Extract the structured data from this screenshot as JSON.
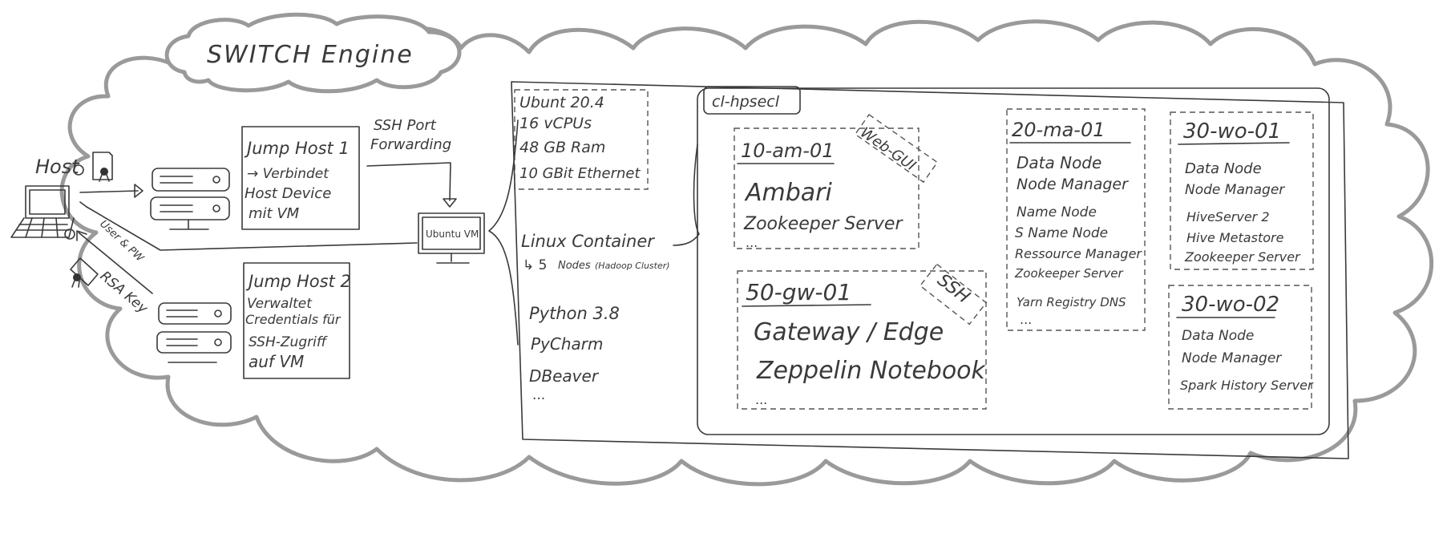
{
  "cloud_title": "SWITCH Engine",
  "host": {
    "label": "Host"
  },
  "jump_host_1": {
    "title": "Jump Host 1",
    "lines": [
      "→ Verbindet",
      "Host Device",
      "mit VM"
    ]
  },
  "jump_host_2": {
    "title": "Jump Host 2",
    "lines": [
      "Verwaltet",
      "Credentials für",
      "SSH-Zugriff",
      "auf VM"
    ]
  },
  "ssh_forwarding": [
    "SSH Port",
    "Forwarding"
  ],
  "arrows": {
    "user_pw": "User & PW",
    "rsa_key": "RSA Key"
  },
  "ubuntu_vm": {
    "label": "Ubuntu VM"
  },
  "vm_specs": [
    "Ubunt 20.4",
    "16 vCPUs",
    "48 GB Ram",
    "10 GBit Ethernet"
  ],
  "linux_container": {
    "title": "Linux Container",
    "sub_arrow": "↳ 5",
    "sub_nodes": "Nodes",
    "sub_note": "(Hadoop Cluster)"
  },
  "tools": [
    "Python 3.8",
    "PyCharm",
    "DBeaver",
    "..."
  ],
  "cluster": {
    "name": "cl-hpsecl",
    "node_am": {
      "title": "10-am-01",
      "tag": "Web-GUI",
      "services": [
        "Ambari",
        "Zookeeper Server",
        "..."
      ]
    },
    "node_gw": {
      "title": "50-gw-01",
      "tag": "SSH",
      "services": [
        "Gateway / Edge",
        "Zeppelin Notebook",
        "..."
      ]
    },
    "node_ma": {
      "title": "20-ma-01",
      "services": [
        "Data Node",
        "Node Manager",
        "Name Node",
        "S Name Node",
        "Ressource Manager",
        "Zookeeper Server",
        "Yarn Registry DNS",
        "..."
      ]
    },
    "node_wo1": {
      "title": "30-wo-01",
      "services": [
        "Data Node",
        "Node Manager",
        "HiveServer 2",
        "Hive Metastore",
        "Zookeeper Server"
      ]
    },
    "node_wo2": {
      "title": "30-wo-02",
      "services": [
        "Data Node",
        "Node Manager",
        "Spark History Server"
      ]
    }
  }
}
